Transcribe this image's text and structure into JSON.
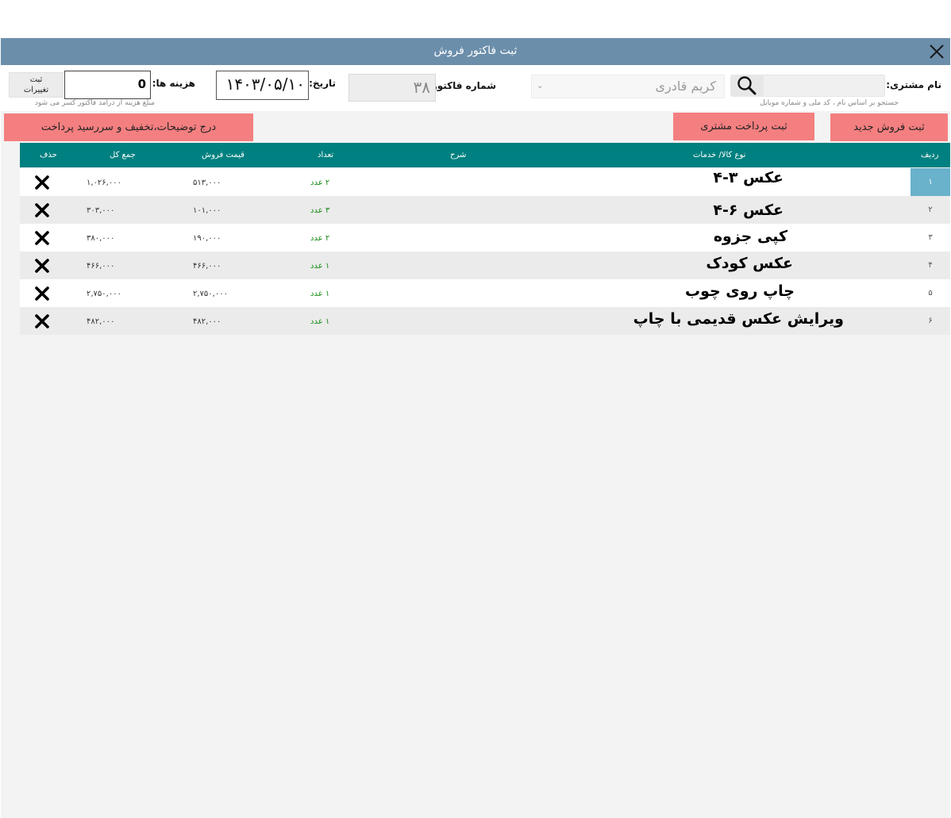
{
  "window": {
    "title": "ثبت فاکتور فروش"
  },
  "customer": {
    "label": "نام مشتری:",
    "search_hint": "جستجو بر اساس نام ، کد ملی و شماره موبایل",
    "selected": "کریم قادری"
  },
  "invoice": {
    "label": "شماره فاکتور:",
    "number": "۳۸"
  },
  "date": {
    "label": "تاریخ:",
    "value": "۱۴۰۳/۰۵/۱۰"
  },
  "costs": {
    "label": "هزینه ها:",
    "value": "0",
    "hint": "مبلغ هزینه از درآمد فاکتور کسر می شود",
    "save_line1": "ثبت",
    "save_line2": "تغییرات"
  },
  "actions": {
    "new_sale": "ثبت فروش جدید",
    "customer_payment": "ثبت پرداخت مشتری",
    "notes_discount": "درج توضیحات،تخفیف و سررسید پرداخت"
  },
  "table": {
    "columns": {
      "row": "ردیف",
      "product": "نوع کالا/ خدمات",
      "description": "شرح",
      "qty": "تعداد",
      "price": "قیمت فروش",
      "total": "جمع کل",
      "delete": "حذف"
    },
    "rows": [
      {
        "index": "۱",
        "product": "عکس ۳-۴",
        "qty": "۲ عدد",
        "price": "۵۱۳,۰۰۰",
        "total": "۱,۰۲۶,۰۰۰"
      },
      {
        "index": "۲",
        "product": "عکس ۶-۴",
        "qty": "۳ عدد",
        "price": "۱۰۱,۰۰۰",
        "total": "۳۰۳,۰۰۰"
      },
      {
        "index": "۳",
        "product": "کپی جزوه",
        "qty": "۲ عدد",
        "price": "۱۹۰,۰۰۰",
        "total": "۳۸۰,۰۰۰"
      },
      {
        "index": "۴",
        "product": "عکس کودک",
        "qty": "۱ عدد",
        "price": "۴۶۶,۰۰۰",
        "total": "۴۶۶,۰۰۰"
      },
      {
        "index": "۵",
        "product": "چاپ روی چوب",
        "qty": "۱ عدد",
        "price": "۲,۷۵۰,۰۰۰",
        "total": "۲,۷۵۰,۰۰۰"
      },
      {
        "index": "۶",
        "product": "ویرایش عکس قدیمی با چاپ",
        "qty": "۱ عدد",
        "price": "۴۸۲,۰۰۰",
        "total": "۴۸۲,۰۰۰"
      }
    ]
  },
  "colors": {
    "titlebar": "#6b8eab",
    "table_header": "#008080",
    "action_button": "#f47f80",
    "selected_row_index": "#6ab1cc",
    "qty_text": "#128a12"
  },
  "icons": {
    "close": "close-icon",
    "search": "search-icon",
    "delete": "delete-x-icon",
    "dropdown": "chevron-down-icon"
  }
}
